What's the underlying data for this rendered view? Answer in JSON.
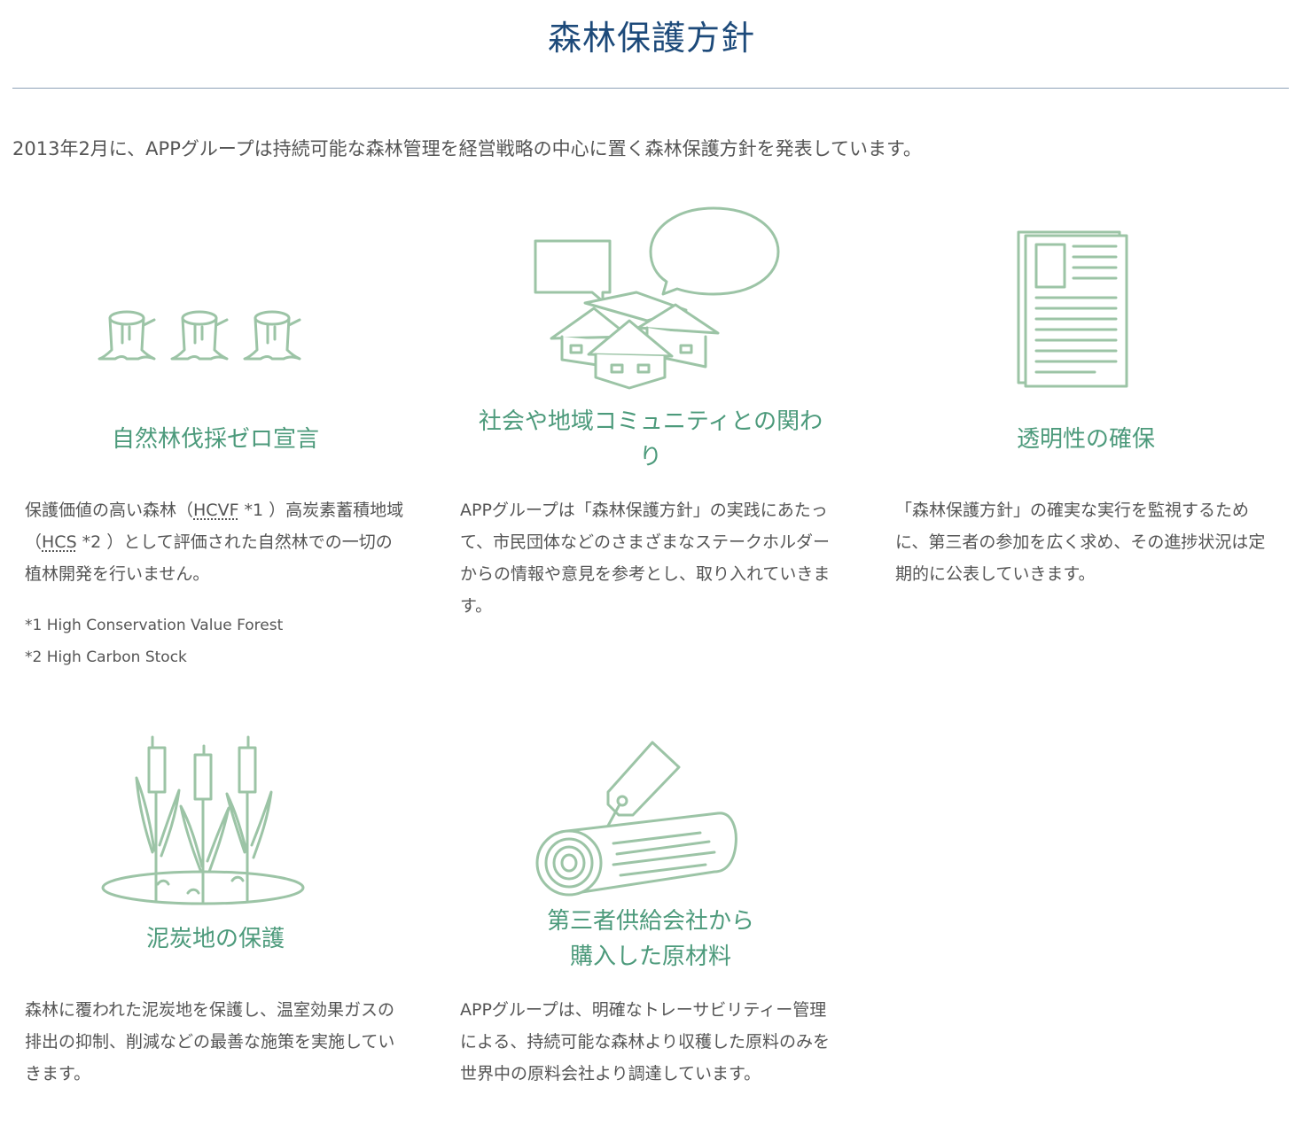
{
  "header": {
    "title": "森林保護方針"
  },
  "intro": "2013年2月に、APPグループは持続可能な森林管理を経営戦略の中心に置く森林保護方針を発表しています。",
  "icon_color": "#9cc4a6",
  "title_color": "#4c9a7b",
  "cards": [
    {
      "icon": "tree-stumps-icon",
      "title": "自然林伐採ゼロ宣言",
      "text_parts": [
        "保護価値の高い森林（",
        "HCVF",
        " *1 ）高炭素蓄積地域（",
        "HCS",
        " *2 ）として評価された自然林での一切の植林開発を行いません。"
      ],
      "notes": [
        "*1 High Conservation Value Forest",
        "*2 High Carbon Stock"
      ]
    },
    {
      "icon": "community-speech-icon",
      "title_lines": [
        "社会や地域コミュニティとの関わ",
        "り"
      ],
      "text": "APPグループは「森林保護方針」の実践にあたって、市民団体などのさまざまなステークホルダーからの情報や意見を参考とし、取り入れていきます。"
    },
    {
      "icon": "document-icon",
      "title": "透明性の確保",
      "text": "「森林保護方針」の確実な実行を監視するために、第三者の参加を広く求め、その進捗状況は定期的に公表していきます。"
    },
    {
      "icon": "cattail-peatland-icon",
      "title": "泥炭地の保護",
      "text": "森林に覆われた泥炭地を保護し、温室効果ガスの排出の抑制、削減などの最善な施策を実施していきます。"
    },
    {
      "icon": "tagged-log-icon",
      "title_lines": [
        "第三者供給会社から",
        "購入した原材料"
      ],
      "text": "APPグループは、明確なトレーサビリティー管理による、持続可能な森林より収穫した原料のみを世界中の原料会社より調達しています。"
    }
  ]
}
